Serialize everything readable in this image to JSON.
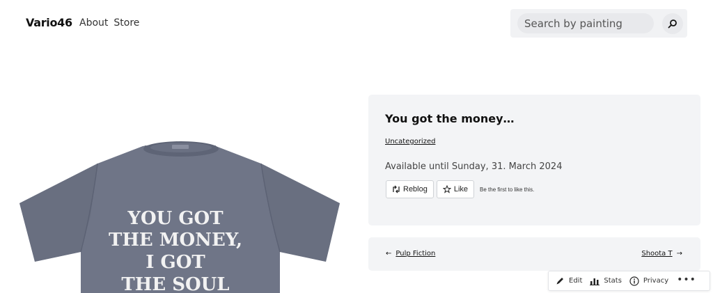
{
  "header": {
    "site_title": "Vario46",
    "nav": [
      {
        "label": "About"
      },
      {
        "label": "Store"
      }
    ],
    "search": {
      "placeholder": "Search by painting",
      "value": ""
    }
  },
  "product_image": {
    "lines": [
      "YOU GOT",
      "THE MONEY,",
      "I GOT",
      "THE SOUL"
    ],
    "shirt_color": "#6f7587",
    "print_color": "#f2f2f2"
  },
  "post": {
    "title": "You got the money…",
    "category": "Uncategorized",
    "availability": "Available until Sunday, 31. March 2024",
    "reblog_label": "Reblog",
    "like_label": "Like",
    "like_note": "Be the first to like this."
  },
  "post_nav": {
    "prev_arrow": "←",
    "prev_label": "Pulp Fiction",
    "next_label": "Shoota T",
    "next_arrow": "→"
  },
  "admin_bar": {
    "edit_label": "Edit",
    "stats_label": "Stats",
    "privacy_label": "Privacy",
    "more_label": "•••"
  }
}
